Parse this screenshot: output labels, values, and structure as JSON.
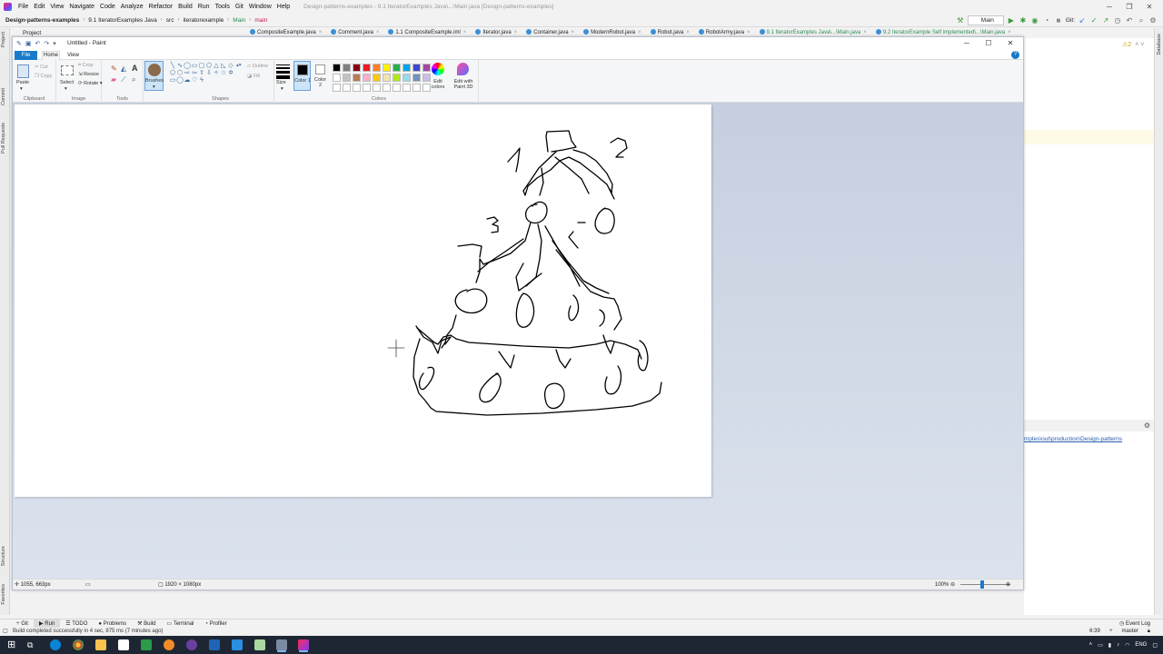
{
  "ide": {
    "menu": [
      "File",
      "Edit",
      "View",
      "Navigate",
      "Code",
      "Analyze",
      "Refactor",
      "Build",
      "Run",
      "Tools",
      "Git",
      "Window",
      "Help"
    ],
    "title": "Design-patterns-examples - 9.1 IteratorExamples Java\\...\\Main.java [Design-patterns-examples]",
    "breadcrumbs": [
      "Design-patterns-examples",
      "9.1 IteratorExamples Java",
      "src",
      "iteratorexample",
      "Main",
      "main"
    ],
    "run_config": "Main",
    "git_label": "Git:",
    "project_tool": "Project",
    "editor_tabs": [
      {
        "label": "CompositeExample.java",
        "green": false
      },
      {
        "label": "Comment.java",
        "green": false
      },
      {
        "label": "1.1 CompositeExample.iml",
        "green": false
      },
      {
        "label": "Iterator.java",
        "green": false
      },
      {
        "label": "Container.java",
        "green": false
      },
      {
        "label": "ModernRobot.java",
        "green": false
      },
      {
        "label": "Robot.java",
        "green": false
      },
      {
        "label": "RobotArmy.java",
        "green": false
      },
      {
        "label": "9.1 IteratorExamples Java\\...\\Main.java",
        "green": true
      },
      {
        "label": "9.2 IteratorExample Self implemented\\...\\Main.java",
        "green": true
      }
    ],
    "left_strip_labels": [
      "Project",
      "Commit",
      "Pull Requests",
      "Structure",
      "Favorites"
    ],
    "right_strip_labels": [
      "Database"
    ],
    "warning_count": "2",
    "run_output": "mples\\out\\production\\Design-patterns",
    "bottom_tools": [
      {
        "label": "Git",
        "active": false
      },
      {
        "label": "Run",
        "active": true
      },
      {
        "label": "TODO",
        "active": false
      },
      {
        "label": "Problems",
        "active": false
      },
      {
        "label": "Build",
        "active": false
      },
      {
        "label": "Terminal",
        "active": false
      },
      {
        "label": "Profiler",
        "active": false
      }
    ],
    "event_log": "Event Log",
    "build_status": "Build completed successfully in 4 sec, 875 ms (7 minutes ago)",
    "cursor_pos": "6:39",
    "branch": "master"
  },
  "paint": {
    "title": "Untitled - Paint",
    "tabs": {
      "file": "File",
      "home": "Home",
      "view": "View"
    },
    "clipboard": {
      "paste": "Paste",
      "cut": "Cut",
      "copy": "Copy",
      "label": "Clipboard"
    },
    "image": {
      "select": "Select",
      "crop": "Crop",
      "resize": "Resize",
      "rotate": "Rotate",
      "label": "Image"
    },
    "tools_label": "Tools",
    "brushes": "Brushes",
    "shapes": {
      "outline": "Outline",
      "fill": "Fill",
      "label": "Shapes"
    },
    "size": "Size",
    "color1": "Color 1",
    "color2": "Color 2",
    "colors_label": "Colors",
    "edit_colors": "Edit colors",
    "edit_3d": "Edit with Paint 3D",
    "palette_row1": [
      "#000000",
      "#7f7f7f",
      "#880015",
      "#ed1c24",
      "#ff7f27",
      "#fff200",
      "#22b14c",
      "#00a2e8",
      "#3f48cc",
      "#a349a4"
    ],
    "palette_row2": [
      "#ffffff",
      "#c3c3c3",
      "#b97a57",
      "#ffaec9",
      "#ffc90e",
      "#efe4b0",
      "#b5e61d",
      "#99d9ea",
      "#7092be",
      "#c8bfe7"
    ],
    "cursor_coords": "1055, 663px",
    "canvas_size": "1920 × 1080px",
    "zoom": "100%"
  },
  "taskbar": {
    "lang": "ENG"
  }
}
